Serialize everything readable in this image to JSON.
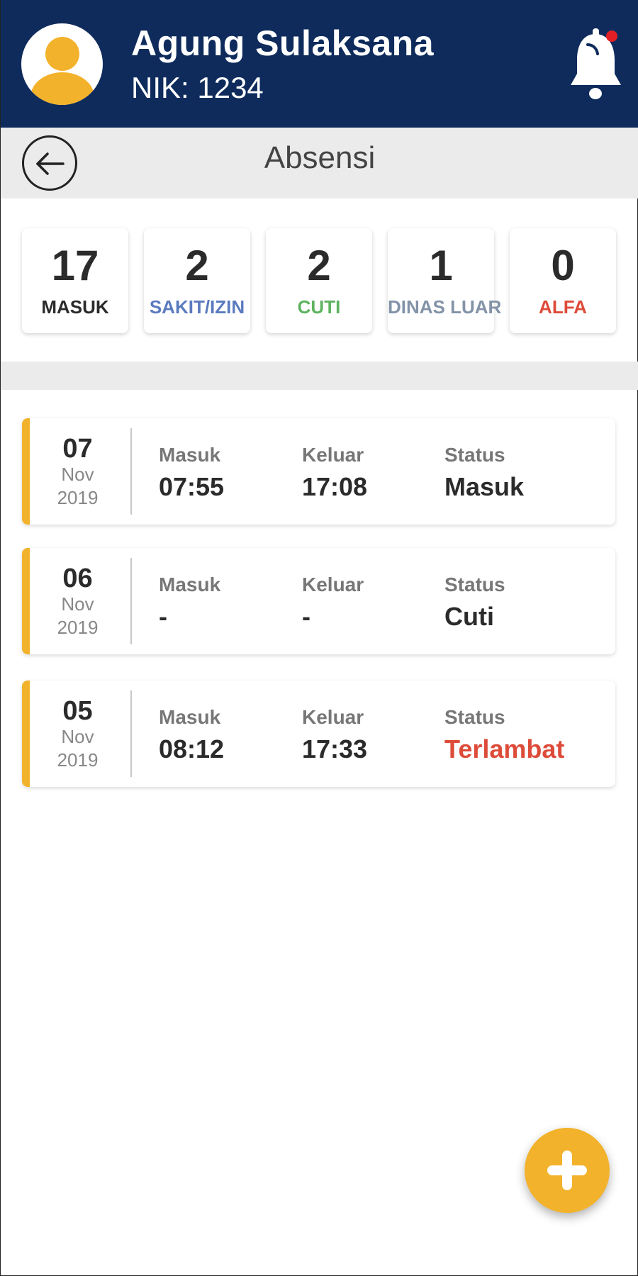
{
  "user": {
    "name": "Agung Sulaksana",
    "nik": "NIK: 1234"
  },
  "page": {
    "title": "Absensi"
  },
  "colors": {
    "header": "#0e2b5c",
    "accent": "#f3b22b",
    "alert": "#e31f26"
  },
  "stats": [
    {
      "value": "17",
      "label": "MASUK",
      "color": "#2b2b2b"
    },
    {
      "value": "2",
      "label": "SAKIT/IZIN",
      "color": "#5b7bbf"
    },
    {
      "value": "2",
      "label": "CUTI",
      "color": "#5fb361"
    },
    {
      "value": "1",
      "label": "DINAS LUAR",
      "color": "#8393a8"
    },
    {
      "value": "0",
      "label": "ALFA",
      "color": "#dd4b39"
    }
  ],
  "records": [
    {
      "day": "07",
      "month": "Nov",
      "year": "2019",
      "in_label": "Masuk",
      "in_time": "07:55",
      "out_label": "Keluar",
      "out_time": "17:08",
      "status_label": "Status",
      "status": "Masuk",
      "status_color": "#2b2b2b"
    },
    {
      "day": "06",
      "month": "Nov",
      "year": "2019",
      "in_label": "Masuk",
      "in_time": "-",
      "out_label": "Keluar",
      "out_time": "-",
      "status_label": "Status",
      "status": "Cuti",
      "status_color": "#2b2b2b"
    },
    {
      "day": "05",
      "month": "Nov",
      "year": "2019",
      "in_label": "Masuk",
      "in_time": "08:12",
      "out_label": "Keluar",
      "out_time": "17:33",
      "status_label": "Status",
      "status": "Terlambat",
      "status_color": "#dd4b39"
    }
  ],
  "icons": {
    "avatar": "user-avatar-icon",
    "notification": "bell-icon",
    "back": "arrow-left-icon",
    "add": "plus-icon"
  }
}
